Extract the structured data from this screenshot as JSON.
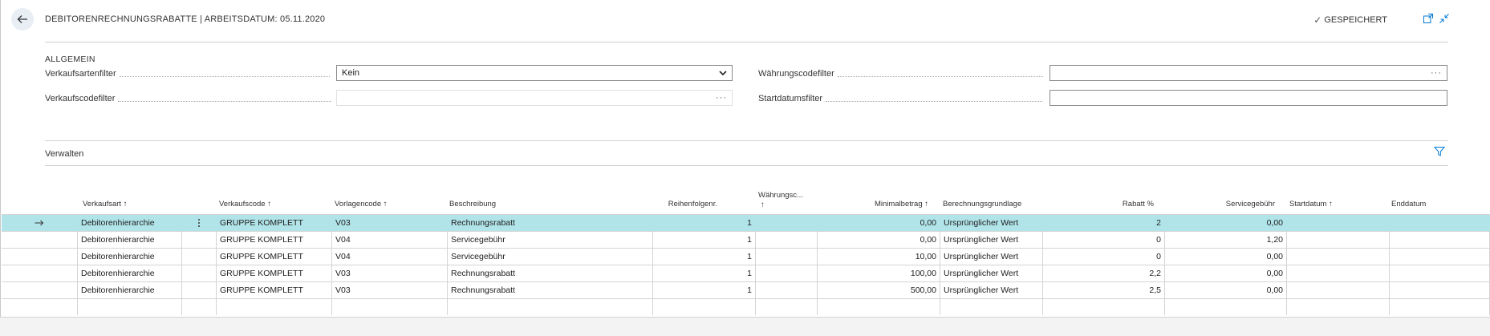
{
  "header": {
    "title": "DEBITORENRECHNUNGSRABATTE | ARBEITSDATUM: 05.11.2020",
    "saved_label": "GESPEICHERT"
  },
  "general": {
    "section_title": "ALLGEMEIN",
    "sales_type_filter_label": "Verkaufsartenfilter",
    "sales_type_filter_value": "Kein",
    "sales_code_filter_label": "Verkaufscodefilter",
    "sales_code_filter_value": "",
    "currency_filter_label": "Währungscodefilter",
    "currency_filter_value": "",
    "start_date_filter_label": "Startdatumsfilter",
    "start_date_filter_value": "",
    "ellipsis": "···"
  },
  "manage": {
    "label": "Verwalten"
  },
  "table": {
    "columns": {
      "sales_type": "Verkaufsart ↑",
      "sales_code": "Verkaufscode ↑",
      "template_code": "Vorlagencode ↑",
      "description": "Beschreibung",
      "sequence": "Reihenfolgenr.",
      "currency_1": "Währungsc...",
      "currency_2": "↑",
      "min_amount": "Minimalbetrag ↑",
      "calc_basis": "Berechnungsgrundlage",
      "discount_pct": "Rabatt %",
      "service_fee": "Servicegebühr",
      "start_date": "Startdatum ↑",
      "end_date": "Enddatum"
    },
    "rows": [
      {
        "sales_type": "Debitorenhierarchie",
        "sales_code": "GRUPPE KOMPLETT",
        "template_code": "V03",
        "description": "Rechnungsrabatt",
        "sequence": "1",
        "currency": "",
        "min_amount": "0,00",
        "calc_basis": "Ursprünglicher Wert",
        "discount_pct": "2",
        "service_fee": "0,00",
        "start_date": "",
        "end_date": ""
      },
      {
        "sales_type": "Debitorenhierarchie",
        "sales_code": "GRUPPE KOMPLETT",
        "template_code": "V04",
        "description": "Servicegebühr",
        "sequence": "1",
        "currency": "",
        "min_amount": "0,00",
        "calc_basis": "Ursprünglicher Wert",
        "discount_pct": "0",
        "service_fee": "1,20",
        "start_date": "",
        "end_date": ""
      },
      {
        "sales_type": "Debitorenhierarchie",
        "sales_code": "GRUPPE KOMPLETT",
        "template_code": "V04",
        "description": "Servicegebühr",
        "sequence": "1",
        "currency": "",
        "min_amount": "10,00",
        "calc_basis": "Ursprünglicher Wert",
        "discount_pct": "0",
        "service_fee": "0,00",
        "start_date": "",
        "end_date": ""
      },
      {
        "sales_type": "Debitorenhierarchie",
        "sales_code": "GRUPPE KOMPLETT",
        "template_code": "V03",
        "description": "Rechnungsrabatt",
        "sequence": "1",
        "currency": "",
        "min_amount": "100,00",
        "calc_basis": "Ursprünglicher Wert",
        "discount_pct": "2,2",
        "service_fee": "0,00",
        "start_date": "",
        "end_date": ""
      },
      {
        "sales_type": "Debitorenhierarchie",
        "sales_code": "GRUPPE KOMPLETT",
        "template_code": "V03",
        "description": "Rechnungsrabatt",
        "sequence": "1",
        "currency": "",
        "min_amount": "500,00",
        "calc_basis": "Ursprünglicher Wert",
        "discount_pct": "2,5",
        "service_fee": "0,00",
        "start_date": "",
        "end_date": ""
      },
      {
        "sales_type": "",
        "sales_code": "",
        "template_code": "",
        "description": "",
        "sequence": "",
        "currency": "",
        "min_amount": "",
        "calc_basis": "",
        "discount_pct": "",
        "service_fee": "",
        "start_date": "",
        "end_date": ""
      }
    ]
  },
  "colors": {
    "selected_row": "#b1e4e9",
    "accent": "#0078d4"
  }
}
